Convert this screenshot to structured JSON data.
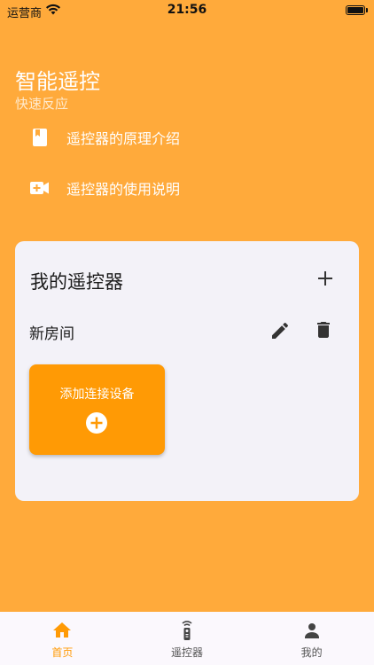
{
  "status_bar": {
    "carrier": "运营商",
    "time": "21:56"
  },
  "header": {
    "title": "智能遥控",
    "subtitle": "快速反应"
  },
  "links": [
    {
      "label": "遥控器的原理介绍",
      "icon": "book-icon"
    },
    {
      "label": "遥控器的使用说明",
      "icon": "video-add-icon"
    }
  ],
  "card": {
    "title": "我的遥控器",
    "room_name": "新房间",
    "add_device_label": "添加连接设备"
  },
  "nav": [
    {
      "label": "首页",
      "icon": "home-icon",
      "active": true
    },
    {
      "label": "遥控器",
      "icon": "remote-icon",
      "active": false
    },
    {
      "label": "我的",
      "icon": "person-icon",
      "active": false
    }
  ],
  "colors": {
    "background": "#FFAA3B",
    "accent": "#FF9A05",
    "card": "#F3F2F8"
  }
}
